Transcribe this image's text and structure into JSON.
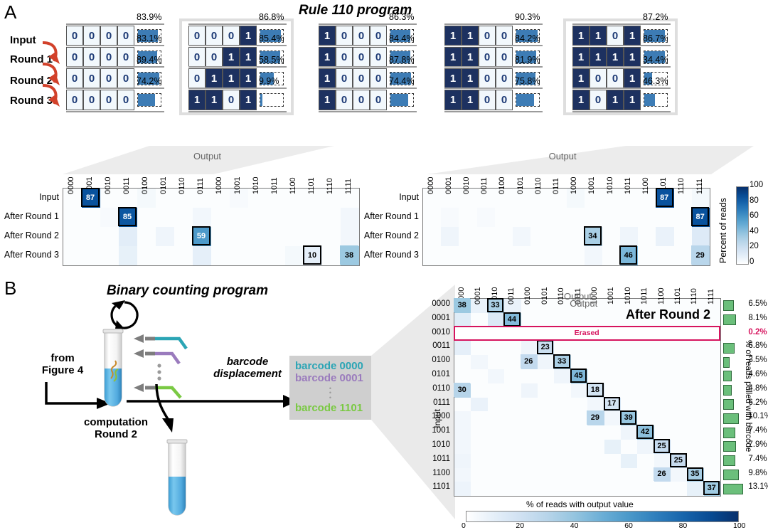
{
  "panelA": {
    "letter": "A",
    "title": "Rule 110 program",
    "row_labels": [
      "Input",
      "Round 1",
      "Round 2",
      "Round 3"
    ],
    "programs": [
      {
        "highlighted": false,
        "rows": [
          {
            "bits": "0000",
            "pct": "83.9%",
            "value": 83.9
          },
          {
            "bits": "0000",
            "pct": "83.1%",
            "value": 83.1
          },
          {
            "bits": "0000",
            "pct": "89.4%",
            "value": 89.4
          },
          {
            "bits": "0000",
            "pct": "74.2%",
            "value": 74.2
          }
        ]
      },
      {
        "highlighted": true,
        "rows": [
          {
            "bits": "0001",
            "pct": "86.8%",
            "value": 86.8
          },
          {
            "bits": "0011",
            "pct": "85.4%",
            "value": 85.4
          },
          {
            "bits": "0111",
            "pct": "58.5%",
            "value": 58.5
          },
          {
            "bits": "1101",
            "pct": "9.9%",
            "value": 9.9
          }
        ]
      },
      {
        "highlighted": false,
        "rows": [
          {
            "bits": "1000",
            "pct": "86.3%",
            "value": 86.3
          },
          {
            "bits": "1000",
            "pct": "84.4%",
            "value": 84.4
          },
          {
            "bits": "1000",
            "pct": "87.8%",
            "value": 87.8
          },
          {
            "bits": "1000",
            "pct": "74.4%",
            "value": 74.4
          }
        ]
      },
      {
        "highlighted": false,
        "rows": [
          {
            "bits": "1100",
            "pct": "90.3%",
            "value": 90.3
          },
          {
            "bits": "1100",
            "pct": "84.2%",
            "value": 84.2
          },
          {
            "bits": "1100",
            "pct": "81.9%",
            "value": 81.9
          },
          {
            "bits": "1100",
            "pct": "75.8%",
            "value": 75.8
          }
        ]
      },
      {
        "highlighted": true,
        "rows": [
          {
            "bits": "1101",
            "pct": "87.2%",
            "value": 87.2
          },
          {
            "bits": "1111",
            "pct": "86.7%",
            "value": 86.7
          },
          {
            "bits": "1001",
            "pct": "34.4%",
            "value": 34.4
          },
          {
            "bits": "1011",
            "pct": "46.3%",
            "value": 46.3
          }
        ]
      }
    ],
    "colorbar": {
      "title": "Percent of reads",
      "ticks": [
        "100",
        "80",
        "60",
        "40",
        "20",
        "0"
      ],
      "min": 0,
      "max": 100
    }
  },
  "chart_data": [
    {
      "type": "heatmap",
      "id": "panelA-heatmap-left",
      "title": "",
      "xlabel": "Output",
      "ylabel": "",
      "categories": [
        "0000",
        "0001",
        "0010",
        "0011",
        "0100",
        "0101",
        "0110",
        "0111",
        "1000",
        "1001",
        "1010",
        "1011",
        "1100",
        "1101",
        "1110",
        "1111"
      ],
      "rows": [
        "Input",
        "After Round 1",
        "After Round 2",
        "After Round 3"
      ],
      "zlim": [
        0,
        100
      ],
      "colorbar_label": "Percent of reads",
      "annotations": [
        {
          "row": 0,
          "col": 1,
          "value": 87,
          "boxed": true
        },
        {
          "row": 1,
          "col": 3,
          "value": 85,
          "boxed": true
        },
        {
          "row": 2,
          "col": 7,
          "value": 59,
          "boxed": true
        },
        {
          "row": 3,
          "col": 13,
          "value": 10,
          "boxed": true
        },
        {
          "row": 3,
          "col": 15,
          "value": 38,
          "boxed": false
        }
      ],
      "background_cells": [
        {
          "row": 0,
          "col": 4,
          "value": 4
        },
        {
          "row": 0,
          "col": 9,
          "value": 3
        },
        {
          "row": 1,
          "col": 2,
          "value": 3
        },
        {
          "row": 1,
          "col": 7,
          "value": 5
        },
        {
          "row": 1,
          "col": 15,
          "value": 5
        },
        {
          "row": 2,
          "col": 3,
          "value": 11
        },
        {
          "row": 2,
          "col": 5,
          "value": 6
        },
        {
          "row": 2,
          "col": 15,
          "value": 5
        },
        {
          "row": 3,
          "col": 3,
          "value": 9
        },
        {
          "row": 3,
          "col": 7,
          "value": 10
        },
        {
          "row": 3,
          "col": 12,
          "value": 4
        }
      ]
    },
    {
      "type": "heatmap",
      "id": "panelA-heatmap-right",
      "title": "",
      "xlabel": "Output",
      "ylabel": "",
      "categories": [
        "0000",
        "0001",
        "0010",
        "0011",
        "0100",
        "0101",
        "0110",
        "0111",
        "1000",
        "1001",
        "1010",
        "1011",
        "1100",
        "1101",
        "1110",
        "1111"
      ],
      "rows": [
        "Input",
        "After Round 1",
        "After Round 2",
        "After Round 3"
      ],
      "zlim": [
        0,
        100
      ],
      "colorbar_label": "Percent of reads",
      "annotations": [
        {
          "row": 0,
          "col": 13,
          "value": 87,
          "boxed": true
        },
        {
          "row": 1,
          "col": 15,
          "value": 87,
          "boxed": true
        },
        {
          "row": 2,
          "col": 9,
          "value": 34,
          "boxed": true
        },
        {
          "row": 3,
          "col": 11,
          "value": 46,
          "boxed": true
        },
        {
          "row": 3,
          "col": 15,
          "value": 29,
          "boxed": false
        }
      ],
      "background_cells": [
        {
          "row": 0,
          "col": 8,
          "value": 4
        },
        {
          "row": 0,
          "col": 15,
          "value": 4
        },
        {
          "row": 1,
          "col": 1,
          "value": 3
        },
        {
          "row": 1,
          "col": 3,
          "value": 3
        },
        {
          "row": 2,
          "col": 1,
          "value": 6
        },
        {
          "row": 2,
          "col": 5,
          "value": 5
        },
        {
          "row": 2,
          "col": 11,
          "value": 6
        },
        {
          "row": 2,
          "col": 13,
          "value": 8
        },
        {
          "row": 2,
          "col": 15,
          "value": 13
        },
        {
          "row": 3,
          "col": 9,
          "value": 5
        }
      ]
    },
    {
      "type": "heatmap",
      "id": "panelB-matrix",
      "title": "After Round 2",
      "xlabel": "Output",
      "ylabel": "Input",
      "categories": [
        "0000",
        "0001",
        "0010",
        "0011",
        "0100",
        "0101",
        "0110",
        "0111",
        "1000",
        "1001",
        "1010",
        "1011",
        "1100",
        "1101",
        "1110",
        "1111"
      ],
      "rows": [
        "0000",
        "0001",
        "0010",
        "0011",
        "0100",
        "0101",
        "0110",
        "0111",
        "1000",
        "1001",
        "1010",
        "1011",
        "1100",
        "1101"
      ],
      "zlim": [
        0,
        100
      ],
      "colorbar_label": "% of reads with output value",
      "colorbar_ticks": [
        "0",
        "20",
        "40",
        "60",
        "80",
        "100"
      ],
      "erased_row": {
        "index": 2,
        "label": "Erased"
      },
      "annotations": [
        {
          "row": 0,
          "col": 0,
          "value": 38,
          "boxed": false
        },
        {
          "row": 0,
          "col": 2,
          "value": 33,
          "boxed": true
        },
        {
          "row": 1,
          "col": 3,
          "value": 44,
          "boxed": true
        },
        {
          "row": 3,
          "col": 5,
          "value": 23,
          "boxed": true
        },
        {
          "row": 4,
          "col": 4,
          "value": 26,
          "boxed": false
        },
        {
          "row": 4,
          "col": 6,
          "value": 33,
          "boxed": true
        },
        {
          "row": 5,
          "col": 7,
          "value": 45,
          "boxed": true
        },
        {
          "row": 6,
          "col": 0,
          "value": 30,
          "boxed": false
        },
        {
          "row": 6,
          "col": 8,
          "value": 18,
          "boxed": true
        },
        {
          "row": 7,
          "col": 9,
          "value": 17,
          "boxed": true
        },
        {
          "row": 8,
          "col": 8,
          "value": 29,
          "boxed": false
        },
        {
          "row": 8,
          "col": 10,
          "value": 39,
          "boxed": true
        },
        {
          "row": 9,
          "col": 11,
          "value": 42,
          "boxed": true
        },
        {
          "row": 10,
          "col": 12,
          "value": 25,
          "boxed": true
        },
        {
          "row": 11,
          "col": 13,
          "value": 25,
          "boxed": true
        },
        {
          "row": 12,
          "col": 12,
          "value": 26,
          "boxed": false
        },
        {
          "row": 12,
          "col": 14,
          "value": 35,
          "boxed": true
        },
        {
          "row": 13,
          "col": 15,
          "value": 37,
          "boxed": true
        }
      ],
      "background_cells": [
        {
          "row": 0,
          "col": 1,
          "value": 8
        },
        {
          "row": 0,
          "col": 3,
          "value": 8
        },
        {
          "row": 1,
          "col": 0,
          "value": 12
        },
        {
          "row": 1,
          "col": 2,
          "value": 14
        },
        {
          "row": 3,
          "col": 0,
          "value": 10
        },
        {
          "row": 3,
          "col": 4,
          "value": 6
        },
        {
          "row": 4,
          "col": 1,
          "value": 5
        },
        {
          "row": 4,
          "col": 5,
          "value": 6
        },
        {
          "row": 5,
          "col": 2,
          "value": 5
        },
        {
          "row": 5,
          "col": 6,
          "value": 6
        },
        {
          "row": 6,
          "col": 4,
          "value": 6
        },
        {
          "row": 6,
          "col": 7,
          "value": 5
        },
        {
          "row": 7,
          "col": 1,
          "value": 8
        },
        {
          "row": 7,
          "col": 8,
          "value": 5
        },
        {
          "row": 8,
          "col": 0,
          "value": 5
        },
        {
          "row": 8,
          "col": 9,
          "value": 5
        },
        {
          "row": 9,
          "col": 0,
          "value": 5
        },
        {
          "row": 9,
          "col": 10,
          "value": 6
        },
        {
          "row": 10,
          "col": 0,
          "value": 5
        },
        {
          "row": 10,
          "col": 9,
          "value": 9
        },
        {
          "row": 10,
          "col": 11,
          "value": 6
        },
        {
          "row": 11,
          "col": 0,
          "value": 6
        },
        {
          "row": 11,
          "col": 10,
          "value": 9
        },
        {
          "row": 11,
          "col": 12,
          "value": 5
        },
        {
          "row": 12,
          "col": 0,
          "value": 5
        },
        {
          "row": 12,
          "col": 13,
          "value": 5
        },
        {
          "row": 13,
          "col": 0,
          "value": 7
        },
        {
          "row": 13,
          "col": 14,
          "value": 9
        }
      ],
      "pull_percent_label": "% of reads pulled with barcode",
      "pull_percents": [
        "6.5%",
        "8.1%",
        "0.2%",
        "6.8%",
        "3.5%",
        "4.6%",
        "4.8%",
        "6.2%",
        "10.1%",
        "7.4%",
        "7.9%",
        "7.4%",
        "9.8%",
        "13.1%"
      ],
      "pull_values": [
        6.5,
        8.1,
        0.2,
        6.8,
        3.5,
        4.6,
        4.8,
        6.2,
        10.1,
        7.4,
        7.9,
        7.4,
        9.8,
        13.1
      ]
    }
  ],
  "panelB": {
    "letter": "B",
    "title": "Binary counting program",
    "from_label": "from\nFigure 4",
    "from_line1": "from",
    "from_line2": "Figure 4",
    "computation_line1": "computation",
    "computation_line2": "Round 2",
    "displacement_line1": "barcode",
    "displacement_line2": "displacement",
    "barcodes": [
      {
        "label": "barcode 0000",
        "color": "#2ba5b5"
      },
      {
        "label": "barcode 0001",
        "color": "#9a7bbd"
      },
      {
        "label": "barcode 1101",
        "color": "#7ac943"
      }
    ],
    "matrix_title": "After Round 2",
    "erased_label": "Erased",
    "erased_pct": "0.2%",
    "output_axis": "Output",
    "input_axis": "Input",
    "colorbar_title": "% of reads with output value",
    "colorbar_ticks": [
      "0",
      "20",
      "40",
      "60",
      "80",
      "100"
    ],
    "pull_axis": "% of reads pulled with barcode"
  },
  "colors": {
    "bit1_bg": "#1d3160",
    "bit0_bg": "#f2f8fc",
    "bar_fill": "#3d7cb5",
    "arrow_red": "#d2412a",
    "erased": "#d6145e",
    "green": "#6bbf7b",
    "heat_max": "#08306b"
  }
}
